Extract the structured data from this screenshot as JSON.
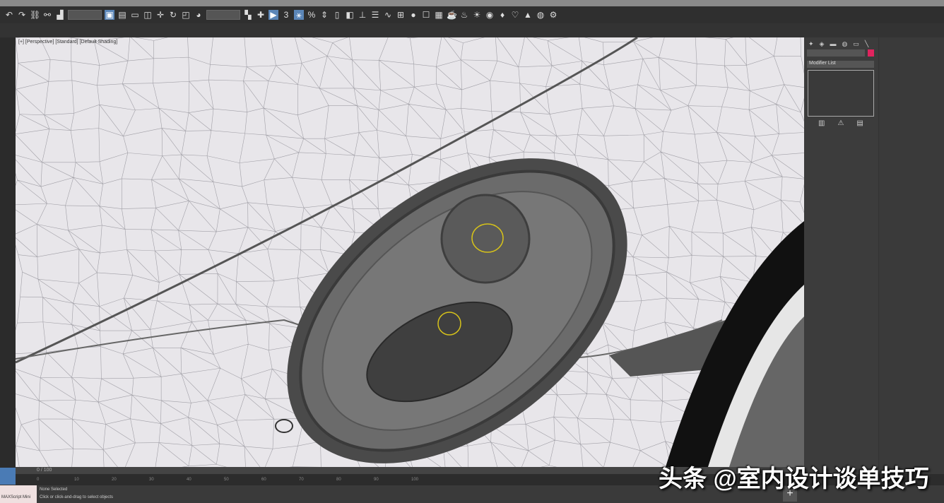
{
  "viewport": {
    "label": "[+] [Perspective] [Standard] [Default Shading]"
  },
  "command_panel": {
    "dropdown": "Modifier List"
  },
  "timeline": {
    "frame_display": "0 / 100",
    "ticks": [
      "0",
      "10",
      "20",
      "30",
      "40",
      "50",
      "60",
      "70",
      "80",
      "90",
      "100"
    ]
  },
  "status": {
    "maxscript": "MAXScript Mini",
    "line1": "None Selected",
    "line2": "Click or click-and-drag to select objects"
  },
  "add_key": "+",
  "watermark": "头条 @室内设计谈单技巧"
}
